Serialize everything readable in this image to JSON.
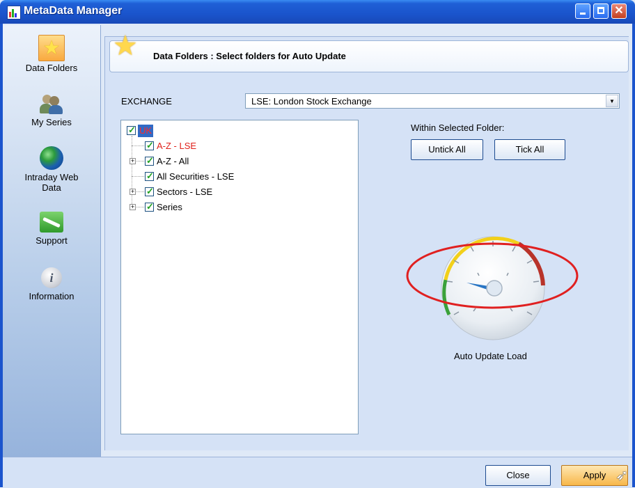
{
  "window": {
    "title": "MetaData Manager"
  },
  "sidebar": {
    "items": [
      {
        "label": "Data Folders",
        "icon": "star-icon"
      },
      {
        "label": "My Series",
        "icon": "people-icon"
      },
      {
        "label": "Intraday Web Data",
        "icon": "globe-icon"
      },
      {
        "label": "Support",
        "icon": "wrench-icon"
      },
      {
        "label": "Information",
        "icon": "info-icon"
      }
    ]
  },
  "header": {
    "title": "Data Folders : Select folders for Auto Update"
  },
  "exchange": {
    "label": "EXCHANGE",
    "selected": "LSE: London Stock Exchange"
  },
  "tree": {
    "root": {
      "label": "UK",
      "checked": true
    },
    "children": [
      {
        "label": "A-Z - LSE",
        "checked": true,
        "expandable": false,
        "color": "#e0201a"
      },
      {
        "label": "A-Z - All",
        "checked": true,
        "expandable": true
      },
      {
        "label": "All Securities - LSE",
        "checked": true,
        "expandable": false
      },
      {
        "label": "Sectors - LSE",
        "checked": true,
        "expandable": true
      },
      {
        "label": "Series",
        "checked": true,
        "expandable": true
      }
    ]
  },
  "folder_actions": {
    "label": "Within Selected Folder:",
    "untick_all": "Untick All",
    "tick_all": "Tick All"
  },
  "gauge": {
    "label": "Auto Update Load",
    "level_fraction": 0.15,
    "colors": {
      "low": "#3aa13a",
      "mid": "#f2d01a",
      "high": "#b8332a",
      "annotation": "#e02020"
    }
  },
  "footer": {
    "close": "Close",
    "apply": "Apply"
  }
}
